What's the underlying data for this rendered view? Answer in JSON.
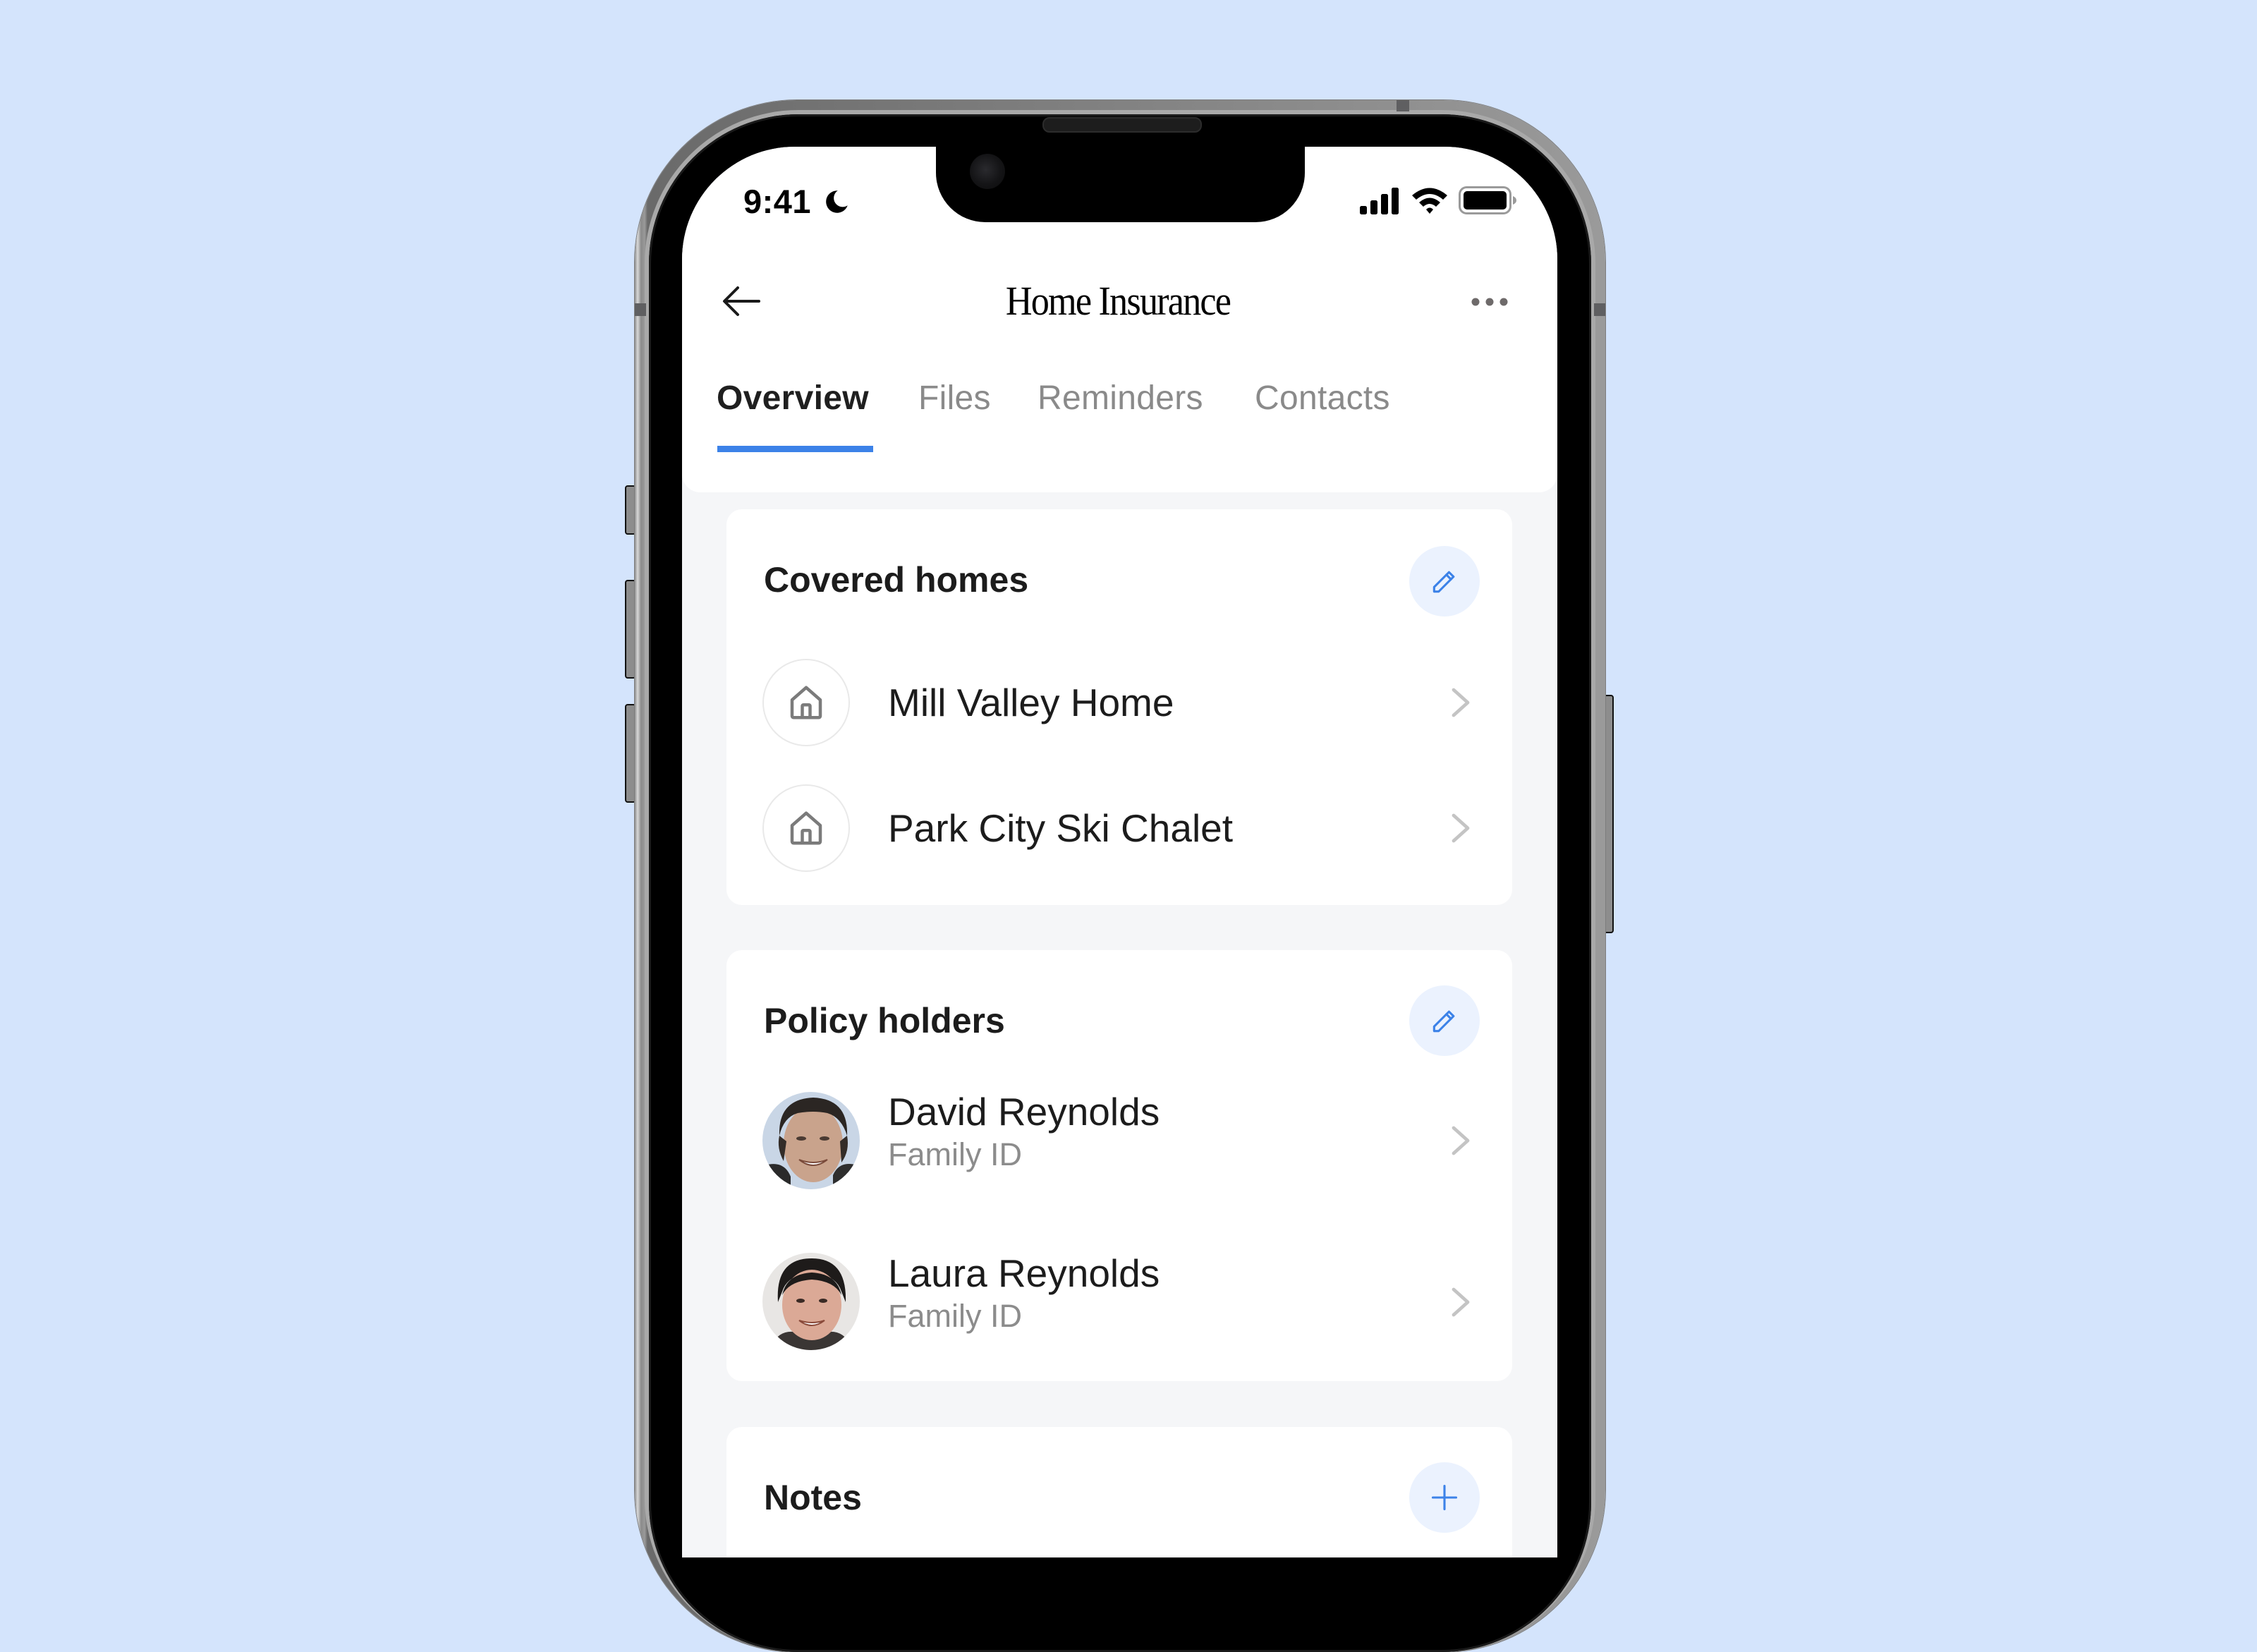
{
  "status_bar": {
    "time": "9:41",
    "focus_icon": "moon-icon",
    "icons": [
      "cellular-signal-icon",
      "wifi-icon",
      "battery-icon"
    ]
  },
  "header": {
    "back_icon": "arrow-left-icon",
    "title": "Home Insurance",
    "more_icon": "more-horizontal-icon"
  },
  "tabs": [
    {
      "label": "Overview",
      "active": true
    },
    {
      "label": "Files",
      "active": false
    },
    {
      "label": "Reminders",
      "active": false
    },
    {
      "label": "Contacts",
      "active": false
    }
  ],
  "sections": {
    "covered_homes": {
      "title": "Covered homes",
      "action_icon": "pencil-icon",
      "items": [
        {
          "label": "Mill Valley Home",
          "icon": "house-icon"
        },
        {
          "label": "Park City Ski Chalet",
          "icon": "house-icon"
        }
      ]
    },
    "policy_holders": {
      "title": "Policy holders",
      "action_icon": "pencil-icon",
      "items": [
        {
          "name": "David Reynolds",
          "subtitle": "Family ID",
          "avatar": "avatar-david"
        },
        {
          "name": "Laura Reynolds",
          "subtitle": "Family ID",
          "avatar": "avatar-laura"
        }
      ]
    },
    "notes": {
      "title": "Notes",
      "action_icon": "plus-icon"
    }
  },
  "colors": {
    "background": "#d4e4fc",
    "accent": "#3c82e8",
    "accent_soft": "#ebf2fe",
    "screen_background": "#f5f6f8",
    "card": "#ffffff",
    "text_primary": "#1c1c1c",
    "text_secondary": "#8c8c8c"
  }
}
